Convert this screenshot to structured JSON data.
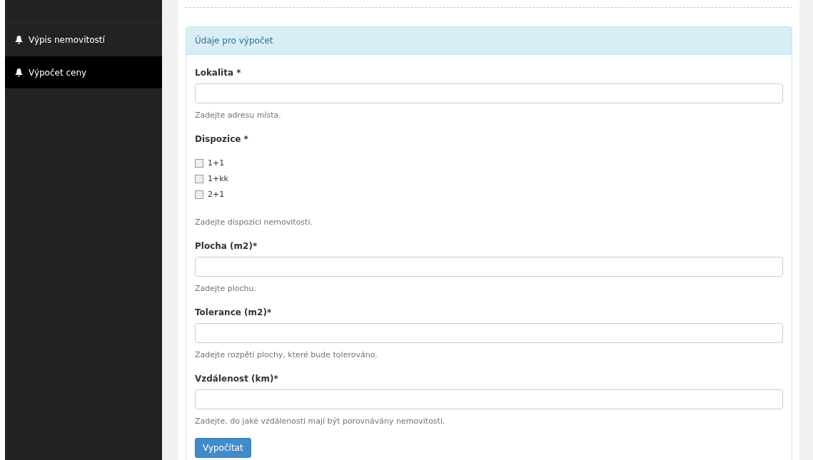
{
  "sidebar": {
    "items": [
      {
        "label": "Výpis nemovitostí",
        "selected": false
      },
      {
        "label": "Výpočet ceny",
        "selected": true
      }
    ]
  },
  "panel": {
    "title": "Údaje pro výpočet",
    "fields": [
      {
        "kind": "text",
        "label": "Lokalita *",
        "help": "Zadejte adresu místa."
      },
      {
        "kind": "checkboxes",
        "label": "Dispozice *",
        "options": [
          {
            "label": "1+1",
            "checked": false
          },
          {
            "label": "1+kk",
            "checked": false
          },
          {
            "label": "2+1",
            "checked": false
          }
        ],
        "help": "Zadejte dispozici nemovitosti."
      },
      {
        "kind": "text",
        "label": "Plocha (m2)*",
        "help": "Zadejte plochu."
      },
      {
        "kind": "text",
        "label": "Tolerance (m2)*",
        "help": "Zadejte rozpětí plochy, které bude tolerováno."
      },
      {
        "kind": "text",
        "label": "Vzdálenost (km)*",
        "help": "Zadejte, do jaké vzdálenosti mají být porovnávány nemovitosti."
      }
    ],
    "button": "Vypočítat"
  }
}
